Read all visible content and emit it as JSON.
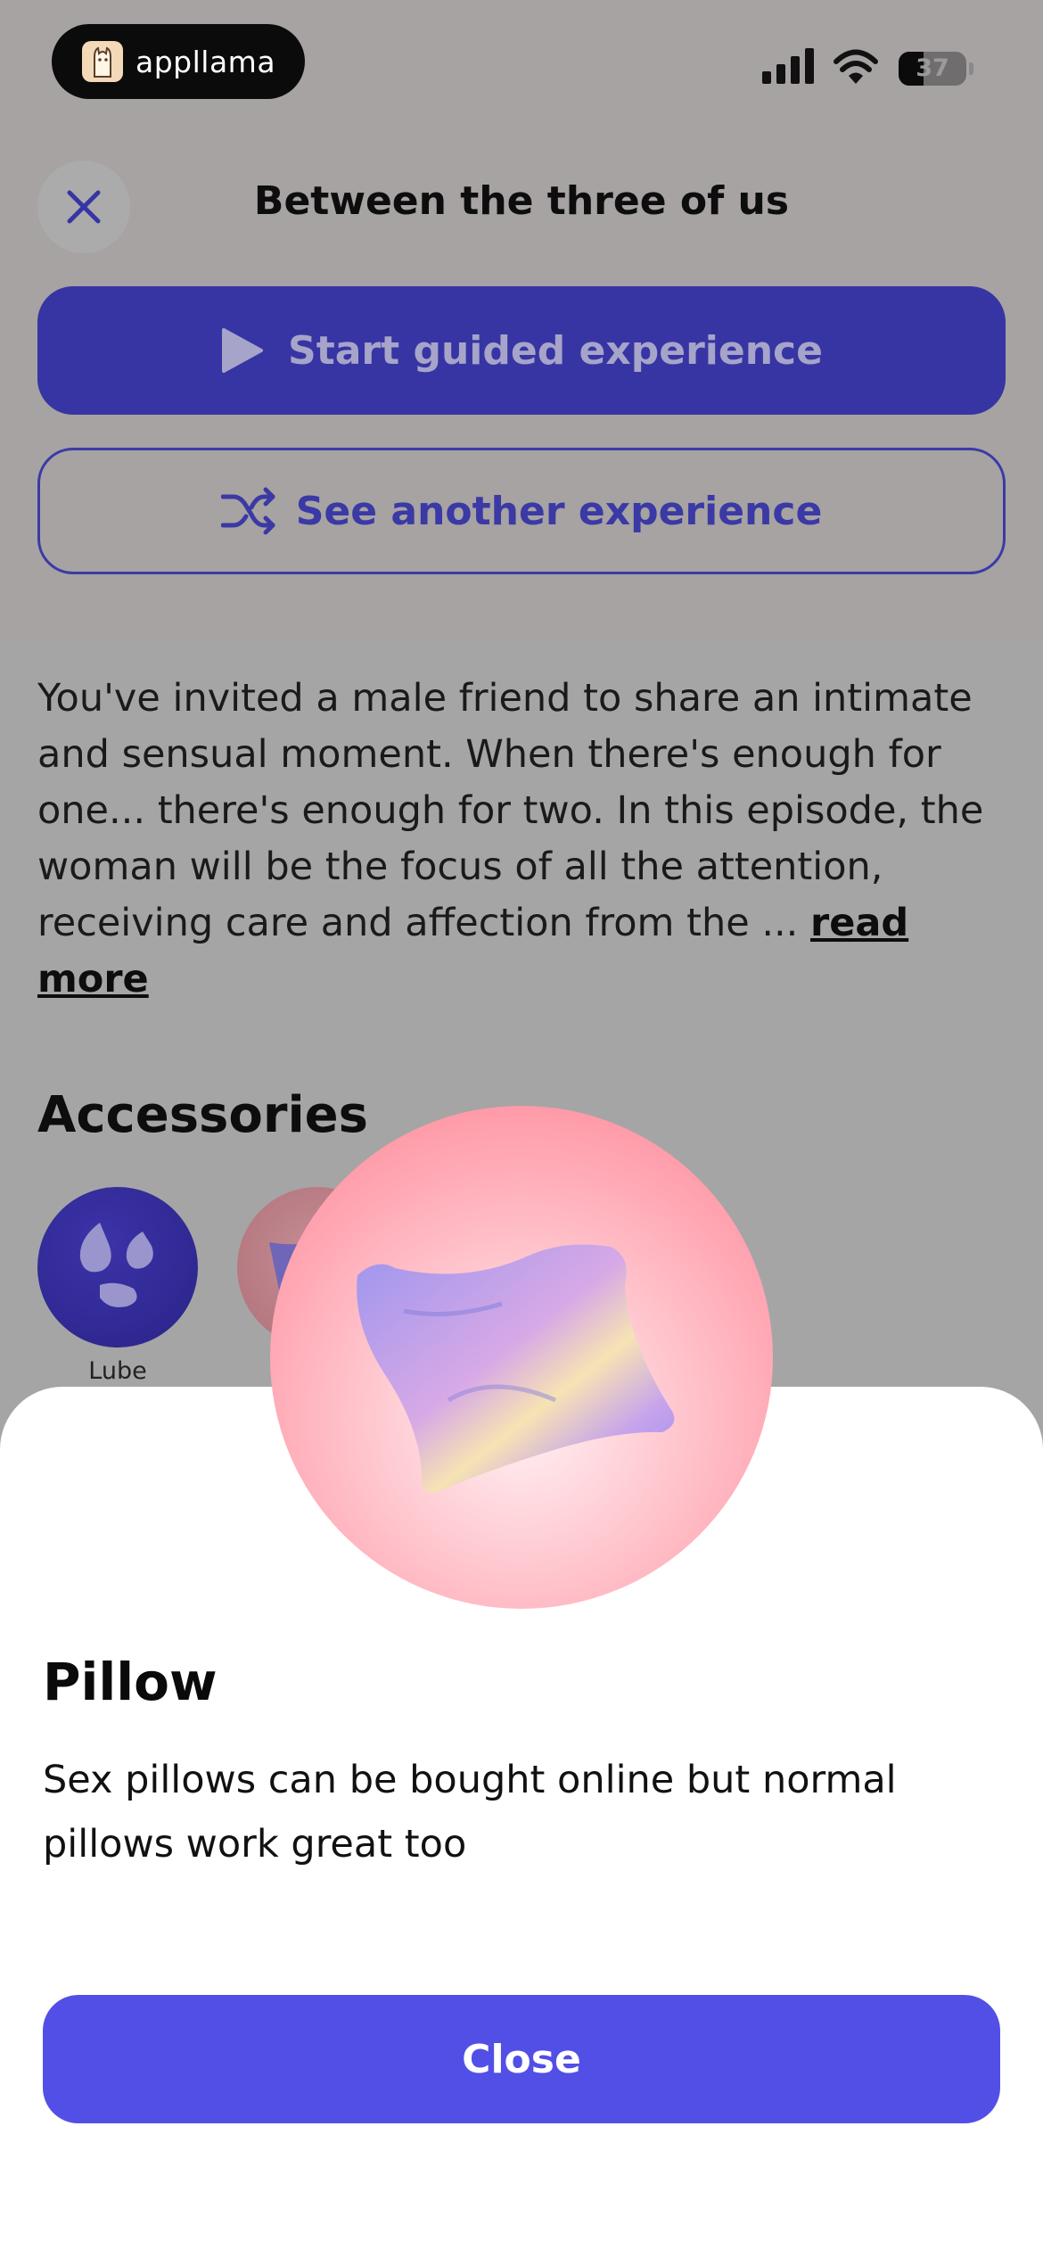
{
  "status_bar": {
    "app_brand": "appllama",
    "battery_level": "37"
  },
  "header": {
    "title": "Between the three of us"
  },
  "actions": {
    "start_label": "Start guided experience",
    "another_label": "See another experience"
  },
  "description": {
    "text": "You've invited a male friend to share an intimate and sensual moment. When there's enough for one... there's enough for two. In this episode, the woman will be the focus of all the attention, receiving care and affection from the ... ",
    "read_more": "read more"
  },
  "accessories": {
    "title": "Accessories",
    "items": [
      {
        "label": "Lube"
      }
    ]
  },
  "sheet": {
    "title": "Pillow",
    "text": "Sex pillows can be bought online but normal pillows work great too",
    "close_label": "Close"
  },
  "colors": {
    "primary": "#3735a3",
    "close_button": "#524fe6",
    "hero_pink": "#ff9aa8",
    "pillow_lavender": "#a39cf0"
  }
}
